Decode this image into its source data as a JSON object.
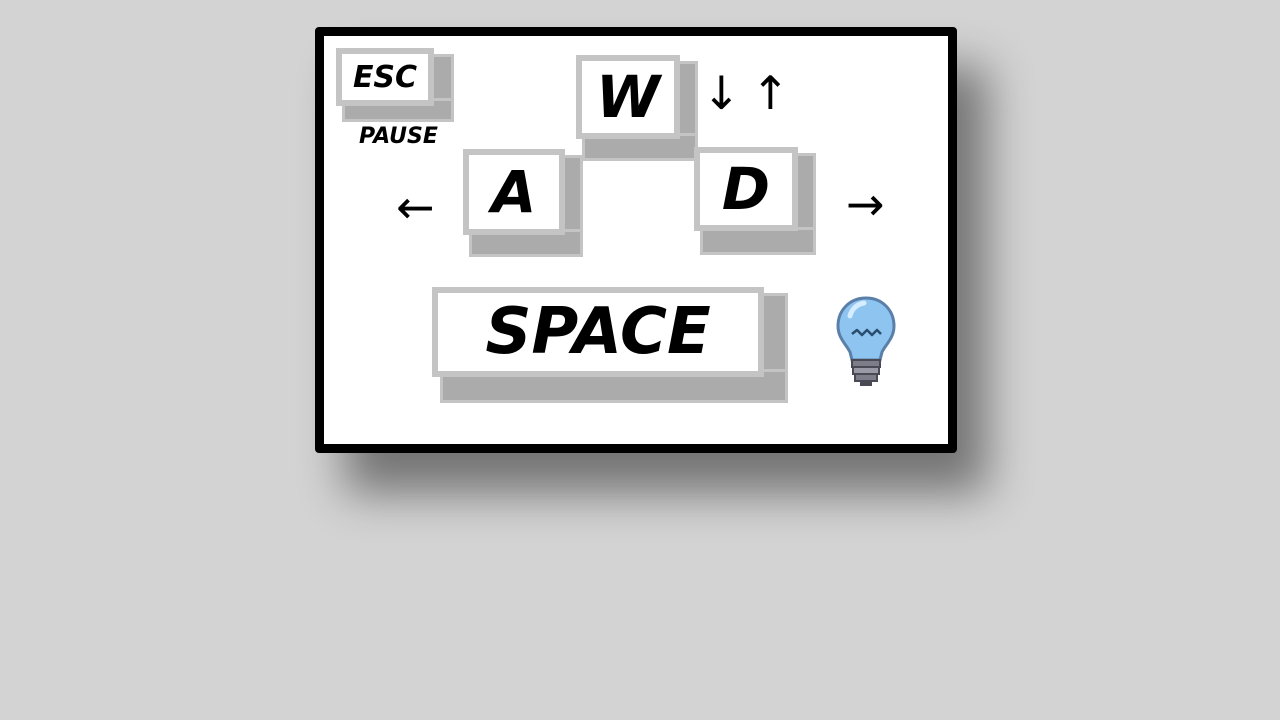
{
  "controls_panel": {
    "esc": {
      "key": "ESC",
      "caption": "PAUSE"
    },
    "w": {
      "key": "W",
      "arrows": [
        "↓",
        "↑"
      ]
    },
    "a": {
      "key": "A",
      "arrow": "←"
    },
    "d": {
      "key": "D",
      "arrow": "→"
    },
    "space": {
      "key": "SPACE"
    },
    "hint_icon": "lightbulb-icon"
  },
  "colors": {
    "background": "#d3d3d3",
    "panel": "#ffffff",
    "panel_border": "#000000",
    "key_border": "#c4c4c4",
    "key_side": "#ababab",
    "bulb": "#8ec5f0"
  }
}
